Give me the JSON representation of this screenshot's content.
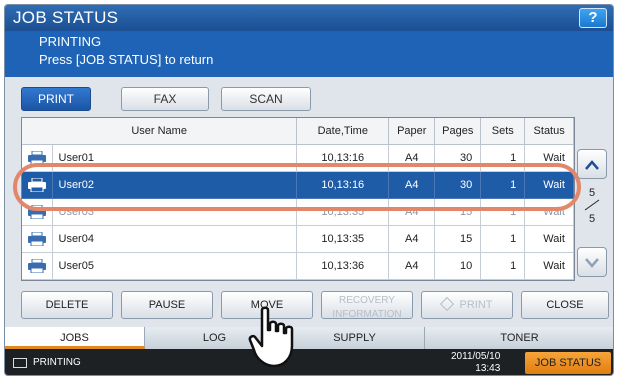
{
  "title": "JOB STATUS",
  "help_label": "?",
  "message": {
    "line1": "PRINTING",
    "line2": "Press [JOB STATUS] to return"
  },
  "job_type_tabs": [
    {
      "label": "PRINT",
      "active": true
    },
    {
      "label": "FAX",
      "active": false
    },
    {
      "label": "SCAN",
      "active": false
    }
  ],
  "table": {
    "headers": [
      "User Name",
      "Date,Time",
      "Paper",
      "Pages",
      "Sets",
      "Status"
    ],
    "rows": [
      {
        "user": "User01",
        "datetime": "10,13:16",
        "paper": "A4",
        "pages": "30",
        "sets": "1",
        "status": "Wait"
      },
      {
        "user": "User02",
        "datetime": "10,13:16",
        "paper": "A4",
        "pages": "30",
        "sets": "1",
        "status": "Wait"
      },
      {
        "user": "User03",
        "datetime": "10,13:35",
        "paper": "A4",
        "pages": "15",
        "sets": "1",
        "status": "Wait"
      },
      {
        "user": "User04",
        "datetime": "10,13:35",
        "paper": "A4",
        "pages": "15",
        "sets": "1",
        "status": "Wait"
      },
      {
        "user": "User05",
        "datetime": "10,13:36",
        "paper": "A4",
        "pages": "10",
        "sets": "1",
        "status": "Wait"
      }
    ],
    "selected_row": 1
  },
  "pager": {
    "current": "5",
    "total": "5"
  },
  "actions": {
    "delete": "DELETE",
    "pause": "PAUSE",
    "move": "MOVE",
    "recovery_line1": "RECOVERY",
    "recovery_line2": "INFORMATION",
    "print": "PRINT",
    "close": "CLOSE"
  },
  "bottom_tabs": [
    {
      "label": "JOBS",
      "active": true
    },
    {
      "label": "LOG",
      "active": false
    },
    {
      "label": "SUPPLY",
      "active": false
    },
    {
      "label": "TONER",
      "active": false
    }
  ],
  "status_bar": {
    "state": "PRINTING",
    "date": "2011/05/10",
    "time": "13:43",
    "job_status_button": "JOB STATUS"
  },
  "colors": {
    "title_blue": "#1c4f93",
    "selected_row": "#1f5ca8",
    "highlight_ring": "#e3876a",
    "orange_button": "#e07d10"
  },
  "icons": [
    "help-icon",
    "printer-icon",
    "chevron-up-icon",
    "chevron-down-icon",
    "print-diamond-icon",
    "printing-status-icon",
    "pointing-hand-icon"
  ]
}
